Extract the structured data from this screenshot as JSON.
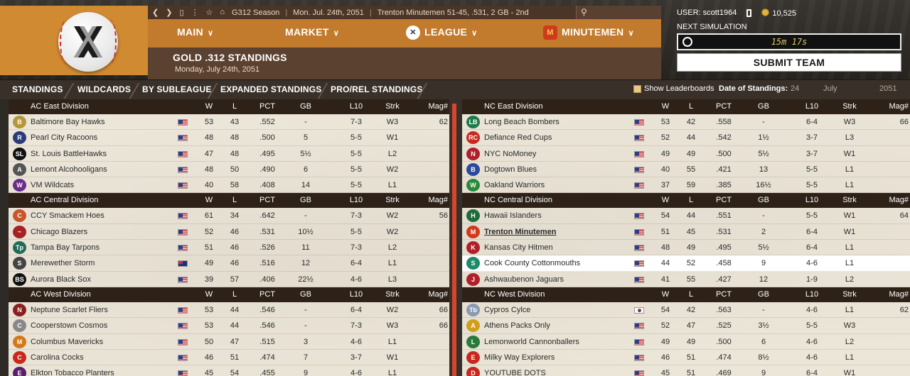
{
  "topbar": {
    "season": "G312 Season",
    "date": "Mon. Jul. 24th, 2051",
    "team_record": "Trenton Minutemen  51-45, .531, 2 GB - 2nd"
  },
  "nav": {
    "main": "MAIN",
    "market": "MARKET",
    "league": "LEAGUE",
    "team": "MINUTEMEN"
  },
  "page": {
    "title": "GOLD .312 STANDINGS",
    "date": "Monday, July 24th, 2051"
  },
  "user": {
    "label": "USER: scott1964",
    "coins": "10,525"
  },
  "simulation": {
    "label": "NEXT SIMULATION",
    "timer": "15m 17s",
    "submit": "SUBMIT TEAM"
  },
  "tabs": [
    "STANDINGS",
    "WILDCARDS",
    "BY SUBLEAGUE",
    "EXPANDED STANDINGS",
    "PRO/REL STANDINGS"
  ],
  "options": {
    "leaderboards": "Show Leaderboards",
    "date_label": "Date of Standings:",
    "day": "24",
    "month": "July",
    "year": "2051"
  },
  "columns": [
    "W",
    "L",
    "PCT",
    "GB",
    "L10",
    "Strk",
    "Mag#"
  ],
  "left_divisions": [
    {
      "name": "AC East Division",
      "teams": [
        {
          "name": "Baltimore Bay Hawks",
          "logo": "B",
          "color": "#b7953c",
          "flag": "us",
          "w": "53",
          "l": "43",
          "pct": ".552",
          "gb": "-",
          "l10": "7-3",
          "strk": "W3",
          "mag": "62"
        },
        {
          "name": "Pearl City Racoons",
          "logo": "R",
          "color": "#2b3a7a",
          "flag": "us",
          "w": "48",
          "l": "48",
          "pct": ".500",
          "gb": "5",
          "l10": "5-5",
          "strk": "W1",
          "mag": ""
        },
        {
          "name": "St. Louis BattleHawks",
          "logo": "SL",
          "color": "#111111",
          "flag": "us",
          "w": "47",
          "l": "48",
          "pct": ".495",
          "gb": "5½",
          "l10": "5-5",
          "strk": "L2",
          "mag": ""
        },
        {
          "name": "Lemont Alcohooligans",
          "logo": "A",
          "color": "#555555",
          "flag": "us",
          "w": "48",
          "l": "50",
          "pct": ".490",
          "gb": "6",
          "l10": "5-5",
          "strk": "W2",
          "mag": ""
        },
        {
          "name": "VM Wildcats",
          "logo": "W",
          "color": "#6a2d8a",
          "flag": "us",
          "w": "40",
          "l": "58",
          "pct": ".408",
          "gb": "14",
          "l10": "5-5",
          "strk": "L1",
          "mag": ""
        }
      ]
    },
    {
      "name": "AC Central Division",
      "teams": [
        {
          "name": "CCY Smackem Hoes",
          "logo": "C",
          "color": "#c8552a",
          "flag": "us",
          "w": "61",
          "l": "34",
          "pct": ".642",
          "gb": "-",
          "l10": "7-3",
          "strk": "W2",
          "mag": "56"
        },
        {
          "name": "Chicago Blazers",
          "logo": "~",
          "color": "#a52222",
          "flag": "us",
          "w": "52",
          "l": "46",
          "pct": ".531",
          "gb": "10½",
          "l10": "5-5",
          "strk": "W2",
          "mag": ""
        },
        {
          "name": "Tampa Bay Tarpons",
          "logo": "Tp",
          "color": "#1f6b5a",
          "flag": "us",
          "w": "51",
          "l": "46",
          "pct": ".526",
          "gb": "11",
          "l10": "7-3",
          "strk": "L2",
          "mag": ""
        },
        {
          "name": "Merewether Storm",
          "logo": "S",
          "color": "#444444",
          "flag": "au",
          "w": "49",
          "l": "46",
          "pct": ".516",
          "gb": "12",
          "l10": "6-4",
          "strk": "L1",
          "mag": ""
        },
        {
          "name": "Aurora Black Sox",
          "logo": "BS",
          "color": "#111111",
          "flag": "us",
          "w": "39",
          "l": "57",
          "pct": ".406",
          "gb": "22½",
          "l10": "4-6",
          "strk": "L3",
          "mag": ""
        }
      ]
    },
    {
      "name": "AC West Division",
      "teams": [
        {
          "name": "Neptune Scarlet Fliers",
          "logo": "N",
          "color": "#8a1f1f",
          "flag": "us",
          "w": "53",
          "l": "44",
          "pct": ".546",
          "gb": "-",
          "l10": "6-4",
          "strk": "W2",
          "mag": "66"
        },
        {
          "name": "Cooperstown Cosmos",
          "logo": "C",
          "color": "#888888",
          "flag": "us",
          "w": "53",
          "l": "44",
          "pct": ".546",
          "gb": "-",
          "l10": "7-3",
          "strk": "W3",
          "mag": "66"
        },
        {
          "name": "Columbus Mavericks",
          "logo": "M",
          "color": "#d07a1a",
          "flag": "us",
          "w": "50",
          "l": "47",
          "pct": ".515",
          "gb": "3",
          "l10": "4-6",
          "strk": "L1",
          "mag": ""
        },
        {
          "name": "Carolina Cocks",
          "logo": "C",
          "color": "#c8281e",
          "flag": "us",
          "w": "46",
          "l": "51",
          "pct": ".474",
          "gb": "7",
          "l10": "3-7",
          "strk": "W1",
          "mag": ""
        },
        {
          "name": "Elkton Tobacco Planters",
          "logo": "E",
          "color": "#5a1f6a",
          "flag": "us",
          "w": "45",
          "l": "54",
          "pct": ".455",
          "gb": "9",
          "l10": "4-6",
          "strk": "L1",
          "mag": ""
        }
      ]
    }
  ],
  "right_divisions": [
    {
      "name": "NC East Division",
      "teams": [
        {
          "name": "Long Beach  Bombers",
          "logo": "LB",
          "color": "#1f7a4a",
          "flag": "us",
          "w": "53",
          "l": "42",
          "pct": ".558",
          "gb": "-",
          "l10": "6-4",
          "strk": "W3",
          "mag": "66"
        },
        {
          "name": "Defiance Red Cups",
          "logo": "RC",
          "color": "#c8281e",
          "flag": "us",
          "w": "52",
          "l": "44",
          "pct": ".542",
          "gb": "1½",
          "l10": "3-7",
          "strk": "L3",
          "mag": ""
        },
        {
          "name": "NYC NoMoney",
          "logo": "N",
          "color": "#b01f2a",
          "flag": "us",
          "w": "49",
          "l": "49",
          "pct": ".500",
          "gb": "5½",
          "l10": "3-7",
          "strk": "W1",
          "mag": ""
        },
        {
          "name": "Dogtown Blues",
          "logo": "B",
          "color": "#2a4a9a",
          "flag": "us",
          "w": "40",
          "l": "55",
          "pct": ".421",
          "gb": "13",
          "l10": "5-5",
          "strk": "L1",
          "mag": ""
        },
        {
          "name": "Oakland Warriors",
          "logo": "W",
          "color": "#2a8a3a",
          "flag": "us",
          "w": "37",
          "l": "59",
          "pct": ".385",
          "gb": "16½",
          "l10": "5-5",
          "strk": "L1",
          "mag": ""
        }
      ]
    },
    {
      "name": "NC Central Division",
      "teams": [
        {
          "name": "Hawaii Islanders",
          "logo": "H",
          "color": "#1f6b3a",
          "flag": "us",
          "w": "54",
          "l": "44",
          "pct": ".551",
          "gb": "-",
          "l10": "5-5",
          "strk": "W1",
          "mag": "64"
        },
        {
          "name": "Trenton Minutemen",
          "logo": "M",
          "color": "#d03a1c",
          "flag": "us",
          "w": "51",
          "l": "45",
          "pct": ".531",
          "gb": "2",
          "l10": "6-4",
          "strk": "W1",
          "mag": "",
          "mine": true
        },
        {
          "name": "Kansas City Hitmen",
          "logo": "K",
          "color": "#b01f2a",
          "flag": "us",
          "w": "48",
          "l": "49",
          "pct": ".495",
          "gb": "5½",
          "l10": "6-4",
          "strk": "L1",
          "mag": ""
        },
        {
          "name": "Cook County Cottonmouths",
          "logo": "S",
          "color": "#1f8a6a",
          "flag": "us",
          "w": "44",
          "l": "52",
          "pct": ".458",
          "gb": "9",
          "l10": "4-6",
          "strk": "L1",
          "mag": "",
          "highlight": true
        },
        {
          "name": "Ashwaubenon Jaguars",
          "logo": "J",
          "color": "#b01f2a",
          "flag": "us",
          "w": "41",
          "l": "55",
          "pct": ".427",
          "gb": "12",
          "l10": "1-9",
          "strk": "L2",
          "mag": ""
        }
      ]
    },
    {
      "name": "NC West Division",
      "teams": [
        {
          "name": "Cypros Cylce",
          "logo": "Tb",
          "color": "#8a9ab0",
          "flag": "kr",
          "w": "54",
          "l": "42",
          "pct": ".563",
          "gb": "-",
          "l10": "4-6",
          "strk": "L1",
          "mag": "62"
        },
        {
          "name": "Athens Packs Only",
          "logo": "A",
          "color": "#d0a01a",
          "flag": "us",
          "w": "52",
          "l": "47",
          "pct": ".525",
          "gb": "3½",
          "l10": "5-5",
          "strk": "W3",
          "mag": ""
        },
        {
          "name": "Lemonworld Cannonballers",
          "logo": "L",
          "color": "#2a7a3a",
          "flag": "us",
          "w": "49",
          "l": "49",
          "pct": ".500",
          "gb": "6",
          "l10": "4-6",
          "strk": "L2",
          "mag": ""
        },
        {
          "name": "Milky Way Explorers",
          "logo": "E",
          "color": "#c8281e",
          "flag": "us",
          "w": "46",
          "l": "51",
          "pct": ".474",
          "gb": "8½",
          "l10": "4-6",
          "strk": "L1",
          "mag": ""
        },
        {
          "name": "YOUTUBE DOTS",
          "logo": "D",
          "color": "#c8281e",
          "flag": "us",
          "w": "45",
          "l": "51",
          "pct": ".469",
          "gb": "9",
          "l10": "6-4",
          "strk": "W1",
          "mag": ""
        }
      ]
    }
  ]
}
